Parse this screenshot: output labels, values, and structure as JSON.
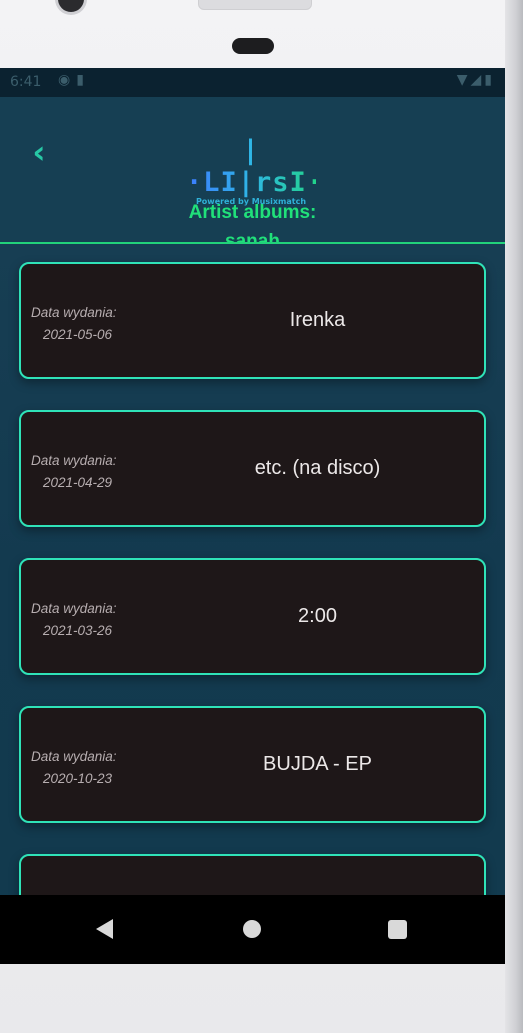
{
  "status_bar": {
    "time": "6:41",
    "left_icons": [
      "cast-icon",
      "sd-card-icon"
    ],
    "right_icons": [
      "wifi-icon",
      "signal-icon",
      "battery-icon"
    ]
  },
  "header": {
    "logo_mark": "|·LI|rsI·|",
    "logo_sub": "Powered by Musixmatch",
    "title_line1": "Artist albums:",
    "title_line2": "sanah",
    "back_icon": "chevron-left-icon"
  },
  "albums": [
    {
      "date_label": "Data wydania:",
      "date": "2021-05-06",
      "title": "Irenka"
    },
    {
      "date_label": "Data wydania:",
      "date": "2021-04-29",
      "title": "etc. (na disco)"
    },
    {
      "date_label": "Data wydania:",
      "date": "2021-03-26",
      "title": "2:00"
    },
    {
      "date_label": "Data wydania:",
      "date": "2020-10-23",
      "title": "BUJDA - EP"
    },
    {
      "date_label": "",
      "date": "",
      "title": ""
    }
  ],
  "nav": {
    "back_icon": "nav-back-icon",
    "home_icon": "nav-home-icon",
    "recents_icon": "nav-recents-icon"
  },
  "colors": {
    "accent_green": "#20e07a",
    "card_border": "#2fe3b8",
    "card_bg": "#1e1718",
    "screen_bg": "#123b4f"
  }
}
